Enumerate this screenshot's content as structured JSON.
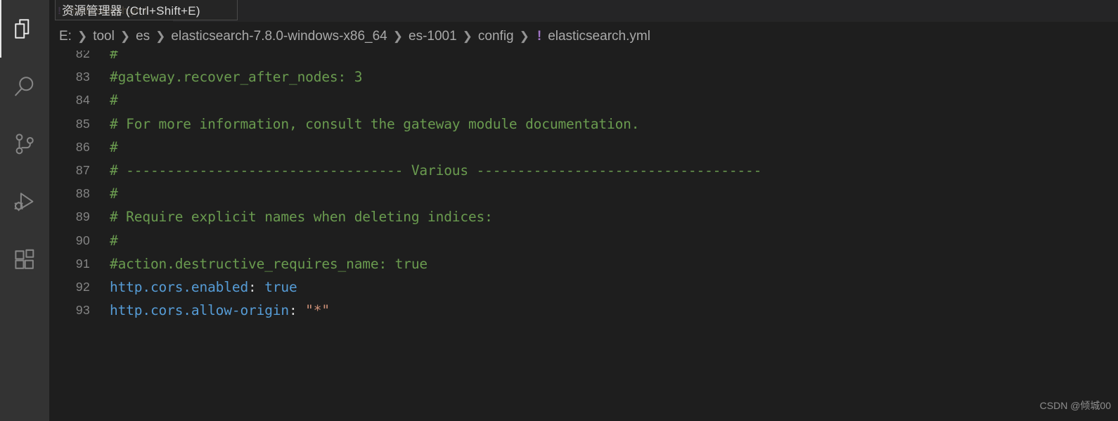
{
  "colors": {
    "activitybar_bg": "#333333",
    "editor_bg": "#1e1e1e",
    "tabbar_bg": "#252526",
    "comment": "#6a9b4f",
    "key": "#569cd6",
    "string": "#ce9178",
    "yaml_icon": "#a074c4",
    "line_number": "#858585"
  },
  "activitybar": {
    "items": [
      {
        "name": "explorer-icon",
        "title": "资源管理器",
        "active": true
      },
      {
        "name": "search-icon",
        "title": "搜索",
        "active": false
      },
      {
        "name": "source-control-icon",
        "title": "源代码管理",
        "active": false
      },
      {
        "name": "run-and-debug-icon",
        "title": "运行和调试",
        "active": false
      },
      {
        "name": "extensions-icon",
        "title": "扩展",
        "active": false
      }
    ]
  },
  "tooltip": {
    "text": "资源管理器 (Ctrl+Shift+E)"
  },
  "tab": {
    "icon": "!",
    "label": "elasticsearch.yml",
    "close": "✕"
  },
  "breadcrumb": {
    "separator": "❯",
    "file_icon": "!",
    "segments": [
      "E:",
      "tool",
      "es",
      "elasticsearch-7.8.0-windows-x86_64",
      "es-1001",
      "config"
    ],
    "file": "elasticsearch.yml"
  },
  "editor": {
    "lines": [
      {
        "number": "82",
        "partial": true,
        "tokens": [
          {
            "t": "#",
            "c": "c-comment"
          }
        ]
      },
      {
        "number": "83",
        "tokens": [
          {
            "t": "#gateway.recover_after_nodes: 3",
            "c": "c-comment"
          }
        ]
      },
      {
        "number": "84",
        "tokens": [
          {
            "t": "#",
            "c": "c-comment"
          }
        ]
      },
      {
        "number": "85",
        "tokens": [
          {
            "t": "# For more information, consult the gateway module documentation.",
            "c": "c-comment"
          }
        ]
      },
      {
        "number": "86",
        "tokens": [
          {
            "t": "#",
            "c": "c-comment"
          }
        ]
      },
      {
        "number": "87",
        "tokens": [
          {
            "t": "# ---------------------------------- Various -----------------------------------",
            "c": "c-comment"
          }
        ]
      },
      {
        "number": "88",
        "tokens": [
          {
            "t": "#",
            "c": "c-comment"
          }
        ]
      },
      {
        "number": "89",
        "tokens": [
          {
            "t": "# Require explicit names when deleting indices:",
            "c": "c-comment"
          }
        ]
      },
      {
        "number": "90",
        "tokens": [
          {
            "t": "#",
            "c": "c-comment"
          }
        ]
      },
      {
        "number": "91",
        "tokens": [
          {
            "t": "#action.destructive_requires_name: true",
            "c": "c-comment"
          }
        ]
      },
      {
        "number": "92",
        "tokens": [
          {
            "t": "http.cors.enabled",
            "c": "c-key"
          },
          {
            "t": ": ",
            "c": "c-punc"
          },
          {
            "t": "true",
            "c": "c-bool"
          }
        ]
      },
      {
        "number": "93",
        "tokens": [
          {
            "t": "http.cors.allow-origin",
            "c": "c-key"
          },
          {
            "t": ": ",
            "c": "c-punc"
          },
          {
            "t": "\"*\"",
            "c": "c-string"
          }
        ]
      }
    ]
  },
  "watermark": {
    "text": "CSDN @倾城00"
  }
}
